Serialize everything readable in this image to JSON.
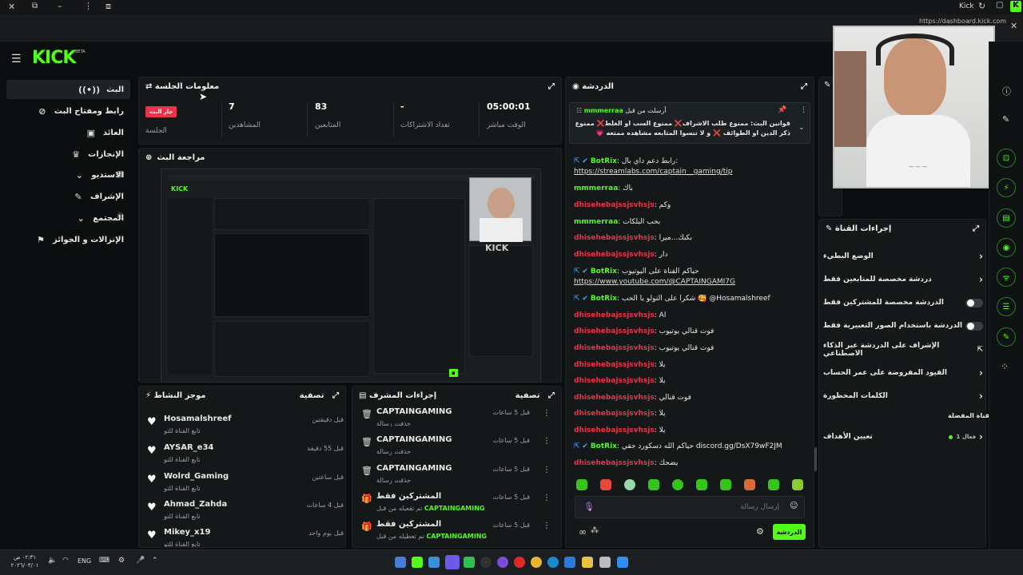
{
  "browser": {
    "title": "Kick",
    "url": "https://dashboard.kick.com"
  },
  "header": {
    "logo": "KICK",
    "logo_badge": "BETA"
  },
  "sidebar": {
    "items": [
      {
        "label": "البث",
        "icon": "broadcast-icon"
      },
      {
        "label": "رابط ومفتاح البث",
        "icon": "link-icon"
      },
      {
        "label": "العائد",
        "icon": "money-icon"
      },
      {
        "label": "الإنجازات",
        "icon": "trophy-icon"
      },
      {
        "label": "الاستديو",
        "icon": "chevron-down-icon"
      },
      {
        "label": "الإشراف",
        "icon": "wrench-icon"
      },
      {
        "label": "المجتمع",
        "icon": "chevron-down-icon"
      },
      {
        "label": "الإنزالات و الجوائز",
        "icon": "gift-icon"
      }
    ]
  },
  "session": {
    "title": "معلومات الجلسة",
    "live_badge": "جار البث",
    "session_label": "الجلسة",
    "viewers_value": "7",
    "viewers_label": "المشاهدين",
    "followers_value": "83",
    "followers_label": "المتابعين",
    "subs_value": "-",
    "subs_label": "تعداد الاشتراكات",
    "time_value": "05:00:01",
    "time_label": "الوقت مباشر"
  },
  "preview": {
    "title": "مراجعة البث"
  },
  "activity": {
    "title": "موجز النشاط",
    "filter": "تصفية",
    "items": [
      {
        "name": "Hosamalshreef",
        "sub": "تابع القناة للتو",
        "time": "قبل دقيقتين"
      },
      {
        "name": "AYSAR_e34",
        "sub": "تابع القناة للتو",
        "time": "قبل 55 دقيقة"
      },
      {
        "name": "Wolrd_Gaming",
        "sub": "تابع القناة للتو",
        "time": "قبل ساعتين"
      },
      {
        "name": "Ahmad_Zahda",
        "sub": "تابع القناة للتو",
        "time": "قبل 4 ساعات"
      },
      {
        "name": "Mikey_x19",
        "sub": "تابع القناة للتو",
        "time": "قبل يوم واحد"
      }
    ]
  },
  "mod_actions": {
    "title": "إجراءات المشرف",
    "filter": "تصفية",
    "items": [
      {
        "name": "CAPTAINGAMING",
        "sub": "حذفت رسالة",
        "time": "قبل 5 ساعات",
        "icon": "trash-icon",
        "by": ""
      },
      {
        "name": "CAPTAINGAMING",
        "sub": "حذفت رسالة",
        "time": "قبل 5 ساعات",
        "icon": "trash-icon",
        "by": ""
      },
      {
        "name": "CAPTAINGAMING",
        "sub": "حذفت رسالة",
        "time": "قبل 5 ساعات",
        "icon": "trash-icon",
        "by": ""
      },
      {
        "name": "المشتركين فقط",
        "sub": "تم تفعيله من قبل",
        "time": "قبل 5 ساعات",
        "icon": "gift-icon",
        "by": "CAPTAINGAMING"
      },
      {
        "name": "المشتركين فقط",
        "sub": "تم تعطيله من قبل",
        "time": "قبل 5 ساعات",
        "icon": "gift-icon",
        "by": "CAPTAINGAMING"
      }
    ]
  },
  "chat": {
    "title": "الدردشة",
    "pinned_by": "أرسلت من قبل",
    "pinned_user": "mmmerraa",
    "pinned_text": "قوانين البث: ممنوع طلب الاشراف❌ ممنوع السب او الغلط❌ ممنوع ذكر الدين او الطوائف ❌ و لا تنسوا المتابعه مشاهده ممتعه 💗",
    "messages": [
      {
        "user": "BotRix",
        "color": "green",
        "text": "رابط دعم داي بال:",
        "link": "https://streamlabs.com/captain__gaming/tip"
      },
      {
        "user": "mmmerraa",
        "color": "green",
        "text": "باك",
        "link": ""
      },
      {
        "user": "dhisehebajssjsvhsjs",
        "color": "red",
        "text": "وكم",
        "link": ""
      },
      {
        "user": "mmmerraa",
        "color": "green",
        "text": "بحب البلكات",
        "link": ""
      },
      {
        "user": "dhisehebajssjsvhsjs",
        "color": "red",
        "text": "بكبك...ميرا",
        "link": ""
      },
      {
        "user": "dhisehebajssjsvhsjs",
        "color": "red",
        "text": "دار",
        "link": ""
      },
      {
        "user": "BotRix",
        "color": "green",
        "text": "حياكم القناة على اليوتيوب",
        "link": "https://www.youtube.com/@CAPTAINGAMI7G"
      },
      {
        "user": "BotRix",
        "color": "green",
        "text": "شكراً على التولو يا الحب 🥰 @Hosamalshreef",
        "link": ""
      },
      {
        "user": "dhisehebajssjsvhsjs",
        "color": "red",
        "text": "Al",
        "link": ""
      },
      {
        "user": "dhisehebajssjsvhsjs",
        "color": "red",
        "text": "فوت قنالي يوتيوب",
        "link": ""
      },
      {
        "user": "dhisehebajssjsvhsjs",
        "color": "red",
        "text": "فوت قنالي يوتيوب",
        "link": ""
      },
      {
        "user": "dhisehebajssjsvhsjs",
        "color": "red",
        "text": "يلا",
        "link": ""
      },
      {
        "user": "dhisehebajssjsvhsjs",
        "color": "red",
        "text": "يلا",
        "link": ""
      },
      {
        "user": "dhisehebajssjsvhsjs",
        "color": "red",
        "text": "فوت قنالي",
        "link": ""
      },
      {
        "user": "dhisehebajssjsvhsjs",
        "color": "red",
        "text": "يلا",
        "link": ""
      },
      {
        "user": "dhisehebajssjsvhsjs",
        "color": "red",
        "text": "يلا",
        "link": ""
      },
      {
        "user": "BotRix",
        "color": "green",
        "text": "حياكم الله دسكورد حقي discord.gg/DsX79wF2JM",
        "link": ""
      },
      {
        "user": "dhisehebajssjsvhsjs",
        "color": "red",
        "text": "يضحك",
        "link": ""
      }
    ],
    "input_placeholder": "إرسال رسالة",
    "send_label": "الدردشة"
  },
  "channel_actions": {
    "title": "إجراءات القناة",
    "rows": [
      {
        "label": "الوضع البطيء",
        "control": "chevron"
      },
      {
        "label": "دردشة مخصصة للمتابعين فقط",
        "control": "chevron"
      },
      {
        "label": "الدردشة مخصصة للمشتركين فقط",
        "control": "toggle"
      },
      {
        "label": "الدردشة باستخدام الصور التعبيرية فقط",
        "control": "toggle"
      },
      {
        "label": "الإشراف على الدردشة عبر الذكاء الاصطناعي",
        "control": "external"
      },
      {
        "label": "القيود المفروضة على عمر الحساب",
        "control": "chevron"
      },
      {
        "label": "الكلمات المحظورة",
        "control": "chevron"
      }
    ],
    "favorite_title": "القناة المفضلة",
    "goals_label": "تعيين الأهداف",
    "goals_badge": "فعال 1"
  },
  "taskbar": {
    "time": "٠٢:٣١ ص",
    "date": "٢٠٢٦/٠٣/٠١",
    "lang": "ENG"
  },
  "colors": {
    "brand": "#53fc18",
    "live": "#e8344b",
    "bg": "#0b0e0f"
  }
}
